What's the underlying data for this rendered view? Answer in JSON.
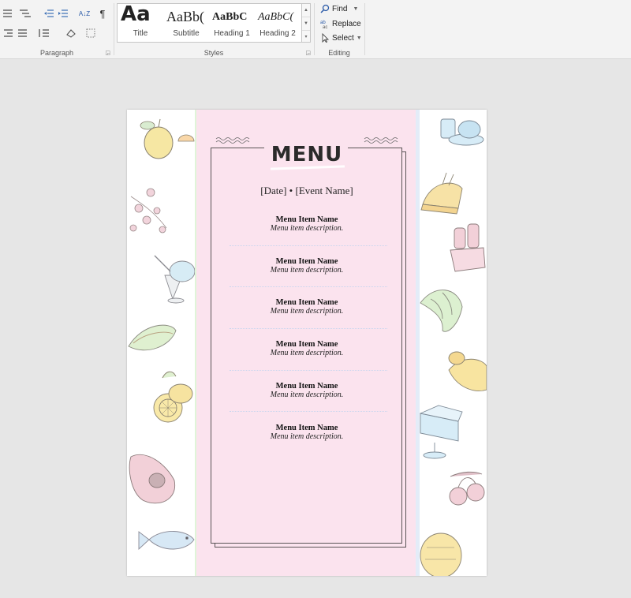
{
  "ribbon": {
    "paragraph_label": "Paragraph",
    "styles_label": "Styles",
    "editing_label": "Editing",
    "pilcrow": "¶",
    "sort": "A↓Z",
    "styles": [
      {
        "sample": "Aa",
        "name": "Title"
      },
      {
        "sample": "AaBb(",
        "name": "Subtitle"
      },
      {
        "sample": "AaBbC",
        "name": "Heading 1"
      },
      {
        "sample": "AaBbC(",
        "name": "Heading 2"
      }
    ],
    "find": "Find",
    "replace": "Replace",
    "select": "Select"
  },
  "document": {
    "title": "MENU",
    "subtitle": "[Date] • [Event Name]",
    "items": [
      {
        "name": "Menu Item Name",
        "description": "Menu item description."
      },
      {
        "name": "Menu Item Name",
        "description": "Menu item description."
      },
      {
        "name": "Menu Item Name",
        "description": "Menu item description."
      },
      {
        "name": "Menu Item Name",
        "description": "Menu item description."
      },
      {
        "name": "Menu Item Name",
        "description": "Menu item description."
      },
      {
        "name": "Menu Item Name",
        "description": "Menu item description."
      }
    ]
  },
  "colors": {
    "panel_pink": "#fbe3ee",
    "frame": "#5a5456",
    "ribbon_bg": "#f3f3f3",
    "canvas_bg": "#e6e6e6"
  }
}
